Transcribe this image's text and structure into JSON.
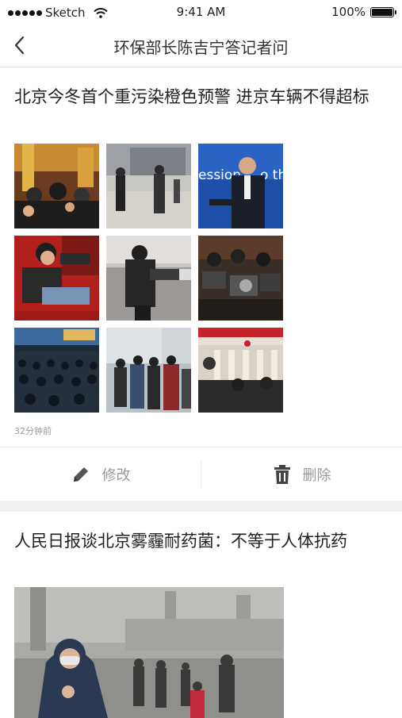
{
  "status_bar": {
    "carrier": "Sketch",
    "time": "9:41 AM",
    "battery_text": "100%",
    "battery_level": 1.0
  },
  "nav": {
    "title": "环保部长陈吉宁答记者问",
    "back_icon": "chevron-left-icon"
  },
  "posts": [
    {
      "title": "北京今冬首个重污染橙色预警 进京车辆不得超标",
      "timestamp": "32分钟前",
      "photo_count": 9,
      "actions": {
        "edit_label": "修改",
        "edit_icon": "pencil-icon",
        "delete_label": "删除",
        "delete_icon": "trash-icon"
      }
    },
    {
      "title": "人民日报谈北京雾霾耐药菌：不等于人体抗药",
      "photo_count": 1
    }
  ],
  "colors": {
    "text": "#222222",
    "secondary": "#999999",
    "divider": "#eeeeee",
    "band": "#efefef"
  }
}
